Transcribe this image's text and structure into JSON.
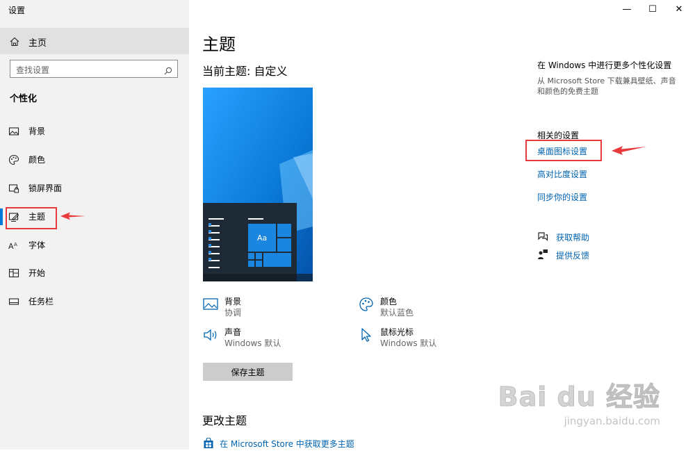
{
  "window": {
    "title": "设置"
  },
  "captions": {
    "minimize": "—",
    "maximize": "☐",
    "close": "✕"
  },
  "sidebar": {
    "home_label": "主页",
    "search_placeholder": "查找设置",
    "section_heading": "个性化",
    "items": [
      {
        "label": "背景",
        "icon": "picture-icon"
      },
      {
        "label": "颜色",
        "icon": "palette-icon"
      },
      {
        "label": "锁屏界面",
        "icon": "lock-screen-icon"
      },
      {
        "label": "主题",
        "icon": "theme-icon",
        "active": true
      },
      {
        "label": "字体",
        "icon": "font-icon"
      },
      {
        "label": "开始",
        "icon": "start-icon"
      },
      {
        "label": "任务栏",
        "icon": "taskbar-icon"
      }
    ]
  },
  "main": {
    "title": "主题",
    "current_theme": "当前主题: 自定义",
    "preview_tile_label": "Aa",
    "props": {
      "background": {
        "name": "背景",
        "value": "协调"
      },
      "color": {
        "name": "颜色",
        "value": "默认蓝色"
      },
      "sound": {
        "name": "声音",
        "value": "Windows 默认"
      },
      "cursor": {
        "name": "鼠标光标",
        "value": "Windows 默认"
      }
    },
    "save_button": "保存主题",
    "change_theme_heading": "更改主题",
    "store_link": "在 Microsoft Store 中获取更多主题"
  },
  "right_panel": {
    "more_heading": "在 Windows 中进行更多个性化设置",
    "more_desc": "从 Microsoft Store 下载兼具壁纸、声音和颜色的免费主题",
    "related_heading": "相关的设置",
    "links": [
      "桌面图标设置",
      "高对比度设置",
      "同步你的设置"
    ],
    "help": "获取帮助",
    "feedback": "提供反馈"
  },
  "watermark": {
    "line1": "Bai du 经验",
    "line2": "jingyan.baidu.com"
  },
  "colors": {
    "accent": "#0078d7",
    "link": "#0063b1",
    "annotation": "#e8393c",
    "sidebar_bg": "#f2f2f2"
  }
}
